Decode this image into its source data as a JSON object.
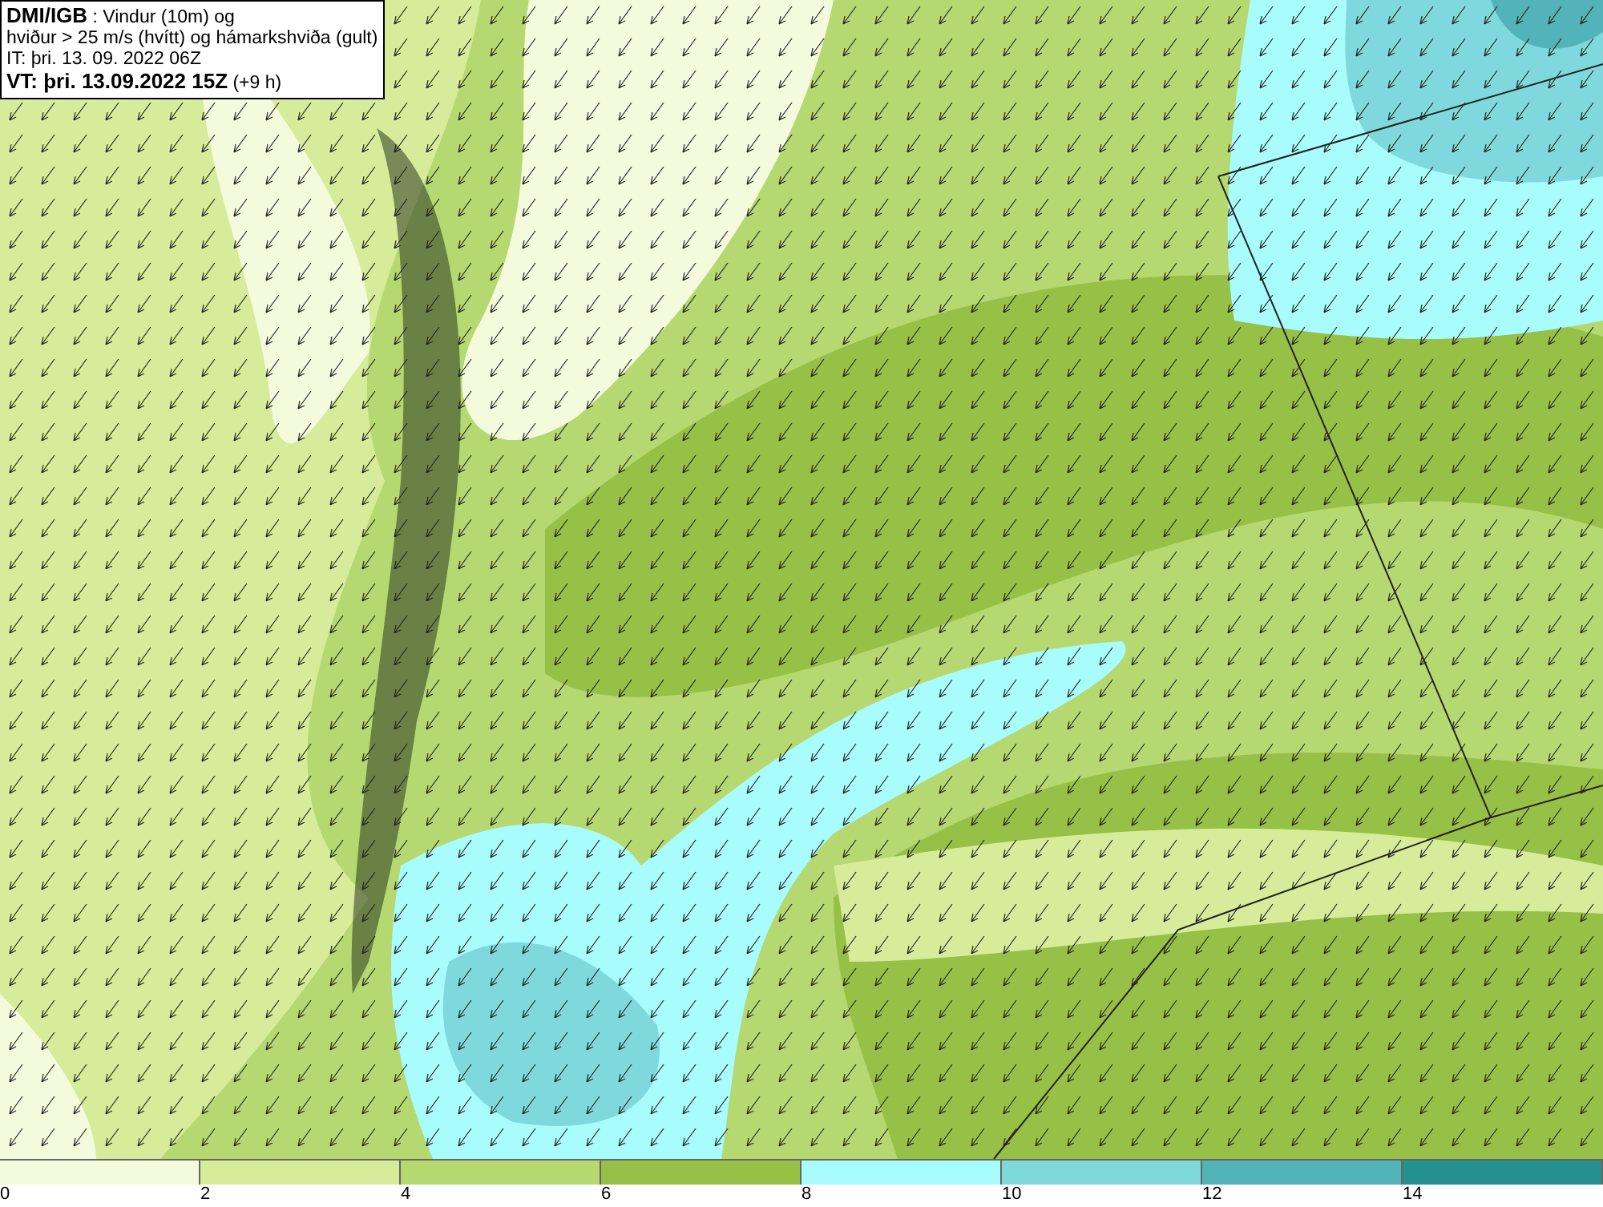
{
  "title_box": {
    "lines": [
      "**DMI/IGB** : Vindur (10m) og",
      "hviður > 25 m/s (hvítt) og hámarkshviða (gult)",
      "IT: þri. 13. 09. 2022 06Z",
      "**VT: þri. 13.09.2022 15Z** (+9 h)"
    ]
  },
  "legend": [
    {
      "label": "0",
      "color": "#f4fbdc"
    },
    {
      "label": "2",
      "color": "#d6ec9a"
    },
    {
      "label": "4",
      "color": "#b6d870"
    },
    {
      "label": "6",
      "color": "#96c046"
    },
    {
      "label": "8",
      "color": "#a8fcfc"
    },
    {
      "label": "10",
      "color": "#7fd8dc"
    },
    {
      "label": "12",
      "color": "#52b4b8"
    },
    {
      "label": "14",
      "color": "#249090"
    }
  ]
}
